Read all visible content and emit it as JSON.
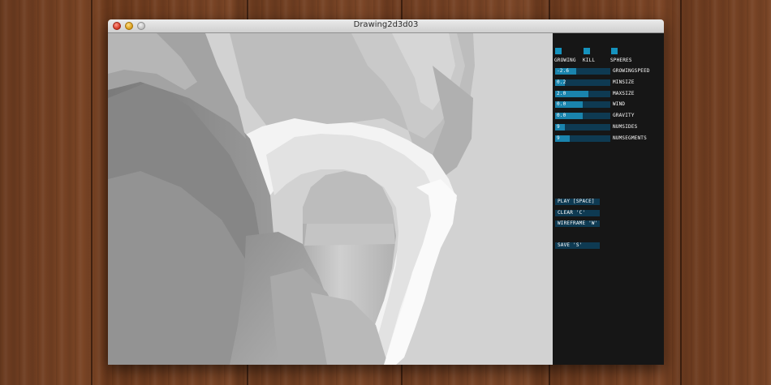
{
  "window": {
    "title": "Drawing2d3d03"
  },
  "panel": {
    "toggles": [
      {
        "label": "GROWING"
      },
      {
        "label": "KILL"
      },
      {
        "label": "SPHERES"
      }
    ],
    "sliders": [
      {
        "label": "GROWINGSPEED",
        "value": "-2.6",
        "fill_fraction": 0.38
      },
      {
        "label": "MINSIZE",
        "value": "0.2",
        "fill_fraction": 0.17
      },
      {
        "label": "MAXSIZE",
        "value": "2.0",
        "fill_fraction": 0.6
      },
      {
        "label": "WIND",
        "value": "0.0",
        "fill_fraction": 0.5
      },
      {
        "label": "GRAVITY",
        "value": "0.0",
        "fill_fraction": 0.5
      },
      {
        "label": "NUMSIDES",
        "value": "9",
        "fill_fraction": 0.18
      },
      {
        "label": "NUMSEGMENTS",
        "value": "9",
        "fill_fraction": 0.27
      }
    ],
    "buttons": [
      {
        "label": "PLAY [SPACE]"
      },
      {
        "label": "CLEAR 'C'"
      },
      {
        "label": "WIREFRAME 'W'"
      },
      {
        "label": "SAVE 'S'"
      }
    ]
  },
  "colors": {
    "control_accent": "#1592bd",
    "control_track": "#0e3a52",
    "panel_background": "#161616",
    "viewport_background": "#d2d2d2"
  }
}
